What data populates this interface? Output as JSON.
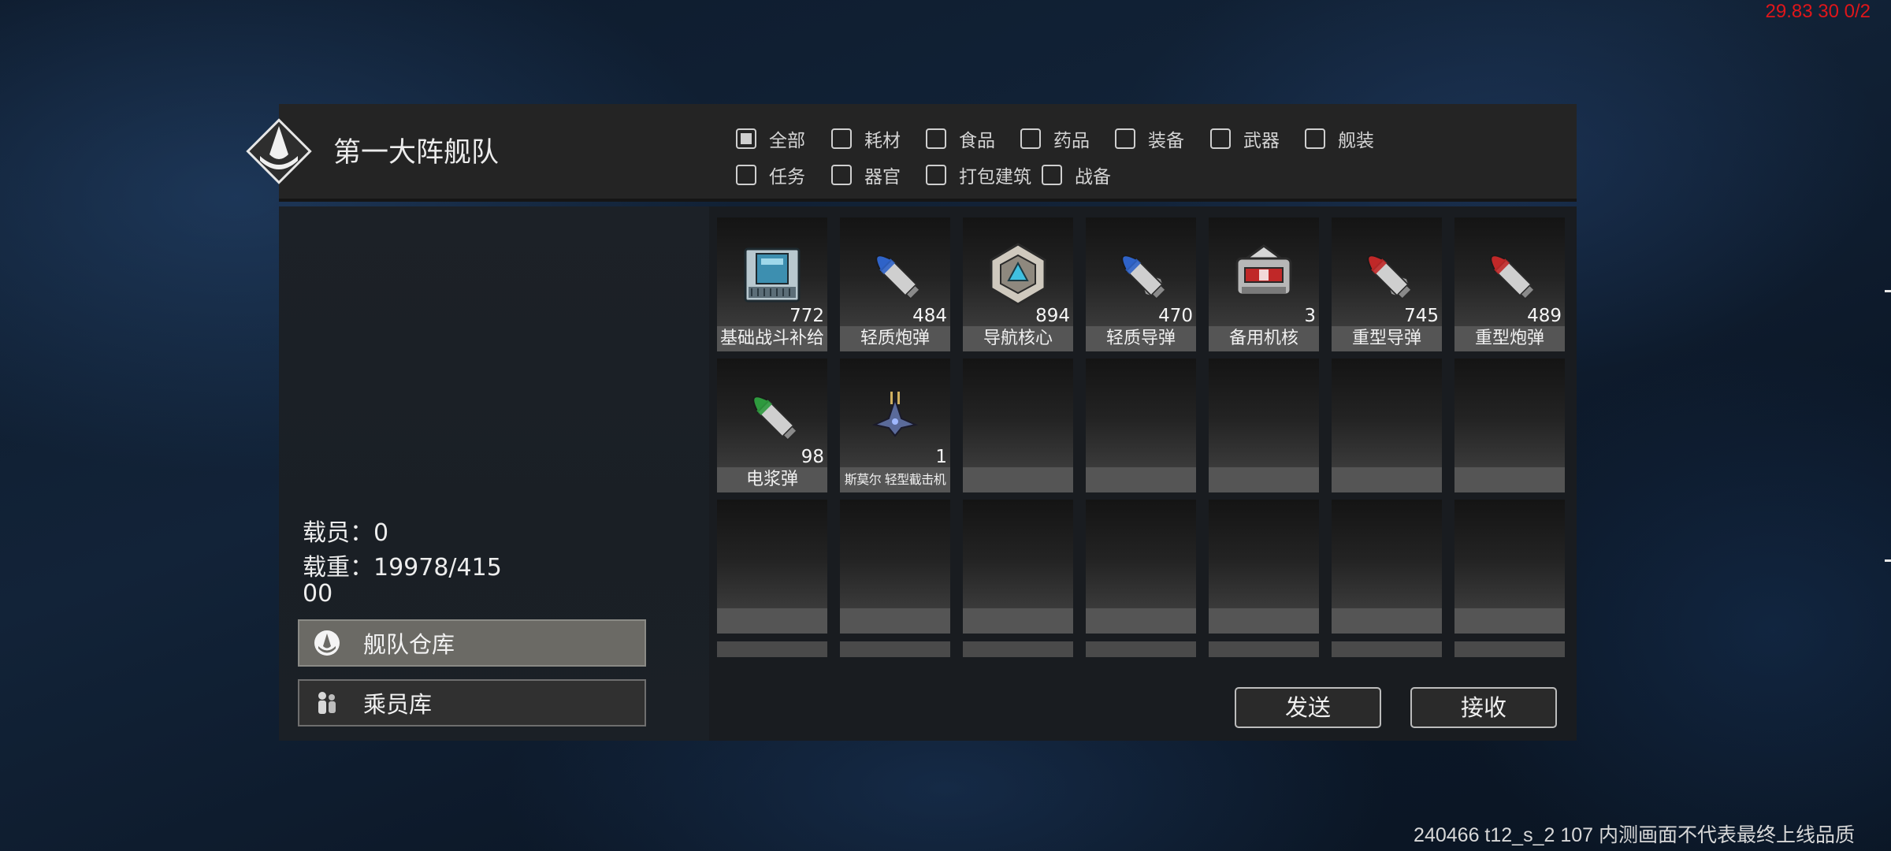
{
  "debug": {
    "fps_text": "29.83 30 0/2"
  },
  "watermark": "240466 t12_s_2 107  内测画面不代表最终上线品质",
  "fleet": {
    "title": "第一大阵舰队"
  },
  "filters": [
    {
      "label": "全部",
      "checked": true
    },
    {
      "label": "耗材",
      "checked": false
    },
    {
      "label": "食品",
      "checked": false
    },
    {
      "label": "药品",
      "checked": false
    },
    {
      "label": "装备",
      "checked": false
    },
    {
      "label": "武器",
      "checked": false
    },
    {
      "label": "舰装",
      "checked": false
    },
    {
      "label": "任务",
      "checked": false
    },
    {
      "label": "器官",
      "checked": false
    },
    {
      "label": "打包建筑",
      "checked": false
    },
    {
      "label": "战备",
      "checked": false
    }
  ],
  "stats": {
    "crew": "载员：0",
    "load": "载重：19978/41500"
  },
  "nav": {
    "warehouse": {
      "label": "舰队仓库",
      "icon": "fleet-emblem-icon"
    },
    "crew": {
      "label": "乘员库",
      "icon": "crew-icon"
    }
  },
  "items": [
    {
      "name": "基础战斗补给",
      "count": "772",
      "icon": "supply-crate-icon",
      "color": "#3d8fb0"
    },
    {
      "name": "轻质炮弹",
      "count": "484",
      "icon": "light-shell-icon",
      "color": "#2f63c8"
    },
    {
      "name": "导航核心",
      "count": "894",
      "icon": "nav-core-icon",
      "color": "#40c0e0"
    },
    {
      "name": "轻质导弹",
      "count": "470",
      "icon": "light-missile-icon",
      "color": "#2f63c8"
    },
    {
      "name": "备用机核",
      "count": "3",
      "icon": "spare-core-icon",
      "color": "#c02828"
    },
    {
      "name": "重型导弹",
      "count": "745",
      "icon": "heavy-missile-icon",
      "color": "#c02828"
    },
    {
      "name": "重型炮弹",
      "count": "489",
      "icon": "heavy-shell-icon",
      "color": "#c02828"
    },
    {
      "name": "电浆弹",
      "count": "98",
      "icon": "plasma-shell-icon",
      "color": "#2e9a3e"
    },
    {
      "name": "斯莫尔 轻型截击机",
      "count": "1",
      "icon": "interceptor-icon",
      "color": "#5a6a9a"
    }
  ],
  "actions": {
    "send": "发送",
    "receive": "接收"
  }
}
